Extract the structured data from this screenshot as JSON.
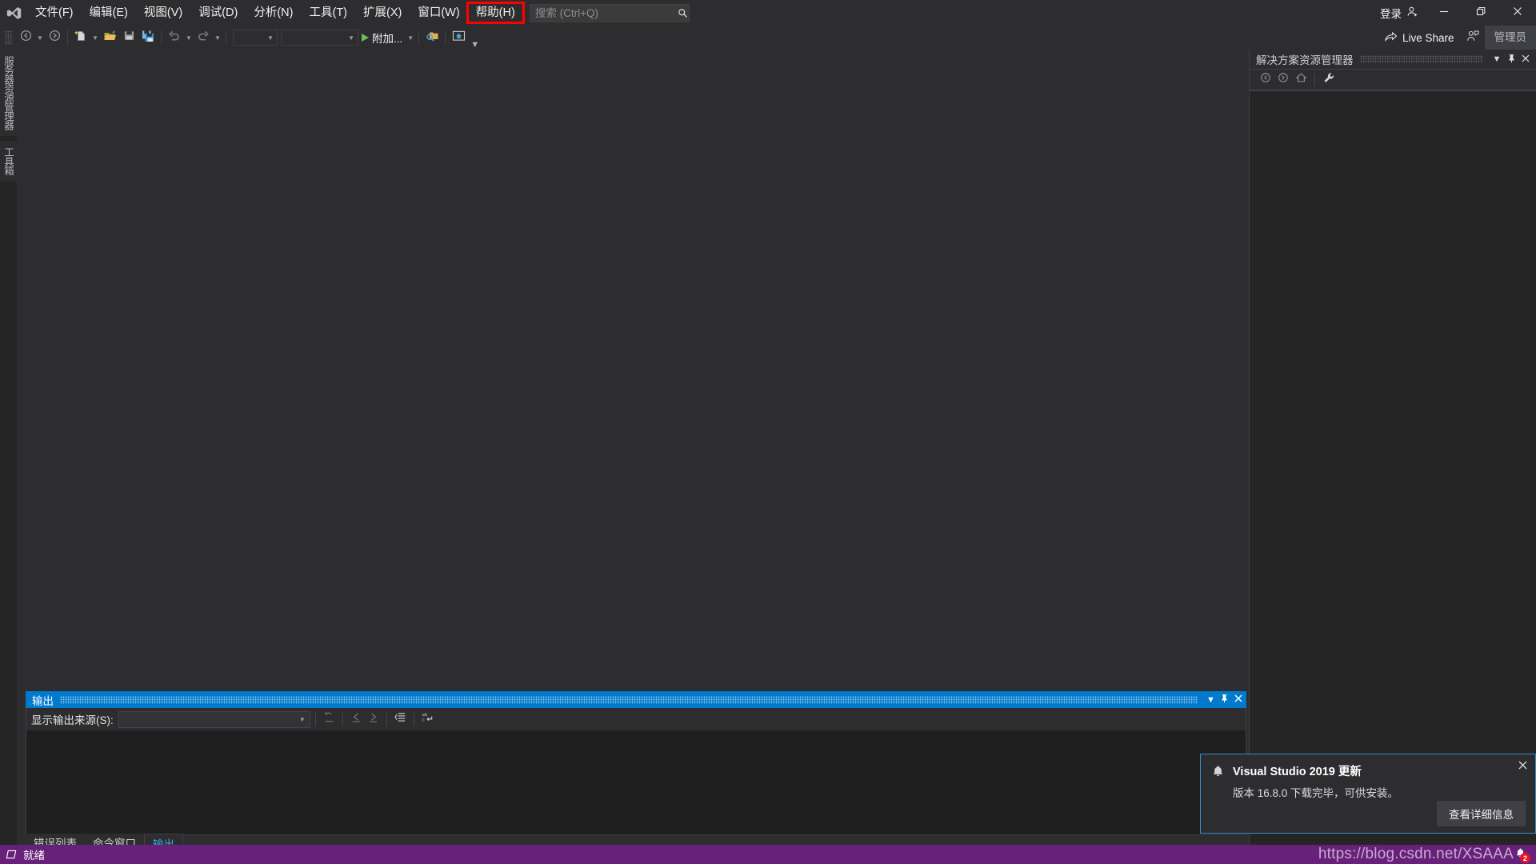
{
  "app": {
    "name": "Visual Studio 2019",
    "logo_icon": "visual-studio-logo-icon",
    "accent_blue": "#007acc",
    "status_purple": "#68217a",
    "highlight_red": "#ff0000"
  },
  "menubar": {
    "items": [
      {
        "label": "文件(F)",
        "name": "menu-file"
      },
      {
        "label": "编辑(E)",
        "name": "menu-edit"
      },
      {
        "label": "视图(V)",
        "name": "menu-view"
      },
      {
        "label": "调试(D)",
        "name": "menu-debug"
      },
      {
        "label": "分析(N)",
        "name": "menu-analyze"
      },
      {
        "label": "工具(T)",
        "name": "menu-tools"
      },
      {
        "label": "扩展(X)",
        "name": "menu-extensions"
      },
      {
        "label": "窗口(W)",
        "name": "menu-window"
      },
      {
        "label": "帮助(H)",
        "name": "menu-help",
        "highlighted": true
      }
    ],
    "highlighted_index": 8
  },
  "search": {
    "placeholder": "搜索 (Ctrl+Q)",
    "value": "",
    "icon": "search-icon"
  },
  "titlebar_right": {
    "signin_label": "登录",
    "signin_icon": "account-add-icon",
    "minimize_icon": "minimize-icon",
    "maximize_icon": "restore-icon",
    "close_icon": "close-icon"
  },
  "toolbar": {
    "navigate_back_icon": "navigate-back-icon",
    "navigate_forward_icon": "navigate-forward-icon",
    "new_item_icon": "new-file-icon",
    "open_file_icon": "open-folder-icon",
    "save_icon": "save-icon",
    "save_all_icon": "save-all-icon",
    "undo_icon": "undo-icon",
    "redo_icon": "redo-icon",
    "combo1_value": "",
    "combo2_value": "",
    "attach_label": "附加...",
    "attach_icon": "play-icon",
    "find_in_files_icon": "find-in-folder-icon",
    "home_icon": "home-screenshot-icon",
    "overflow_icon": "toolbar-overflow-icon"
  },
  "toolbar_right": {
    "live_share_label": "Live Share",
    "live_share_icon": "live-share-icon",
    "feedback_icon": "send-feedback-icon",
    "admin_label": "管理员"
  },
  "left_rail": {
    "tabs": [
      {
        "label": "服务器资源管理器",
        "name": "vtab-server-explorer"
      },
      {
        "label": "工具箱",
        "name": "vtab-toolbox"
      }
    ]
  },
  "solution_explorer": {
    "title": "解决方案资源管理器",
    "header_buttons": [
      {
        "icon": "chevron-down-icon",
        "name": "se-dropdown-button"
      },
      {
        "icon": "pin-icon",
        "name": "se-pin-button"
      },
      {
        "icon": "close-icon",
        "name": "se-close-button"
      }
    ],
    "toolbar_buttons": [
      {
        "icon": "back-arrow-icon",
        "name": "se-back-button"
      },
      {
        "icon": "forward-arrow-icon",
        "name": "se-forward-button"
      },
      {
        "icon": "home-icon",
        "name": "se-home-button"
      },
      {
        "icon": "wrench-icon",
        "name": "se-properties-button"
      }
    ],
    "content": ""
  },
  "output_panel": {
    "title": "输出",
    "header_buttons": [
      {
        "icon": "chevron-down-icon",
        "name": "output-dropdown-button"
      },
      {
        "icon": "pin-icon",
        "name": "output-pin-button"
      },
      {
        "icon": "close-icon",
        "name": "output-close-button"
      }
    ],
    "source_label": "显示输出来源(S):",
    "source_value": "",
    "toolbar_buttons": [
      {
        "icon": "clear-all-icon",
        "name": "output-clear-all-button"
      },
      {
        "icon": "go-to-previous-icon",
        "name": "output-previous-button"
      },
      {
        "icon": "go-to-next-icon",
        "name": "output-next-button"
      },
      {
        "icon": "toggle-wordwrap-icon",
        "name": "output-wordwrap-button"
      },
      {
        "icon": "toggle-line-wrap-icon",
        "name": "output-toggle-wrap-button"
      }
    ],
    "content": "",
    "tabs": [
      {
        "label": "错误列表",
        "name": "tab-error-list",
        "active": false
      },
      {
        "label": "命令窗口",
        "name": "tab-command-window",
        "active": false
      },
      {
        "label": "输出",
        "name": "tab-output",
        "active": true
      }
    ]
  },
  "notification": {
    "icon": "bell-icon",
    "title": "Visual Studio 2019 更新",
    "message": "版本 16.8.0 下载完毕，可供安装。",
    "action_label": "查看详细信息",
    "close_icon": "close-icon"
  },
  "statusbar": {
    "icon": "ready-flag-icon",
    "text": "就绪",
    "notification_icon": "bell-icon",
    "notification_count": "2",
    "watermark": "https://blog.csdn.net/XSAAA"
  }
}
